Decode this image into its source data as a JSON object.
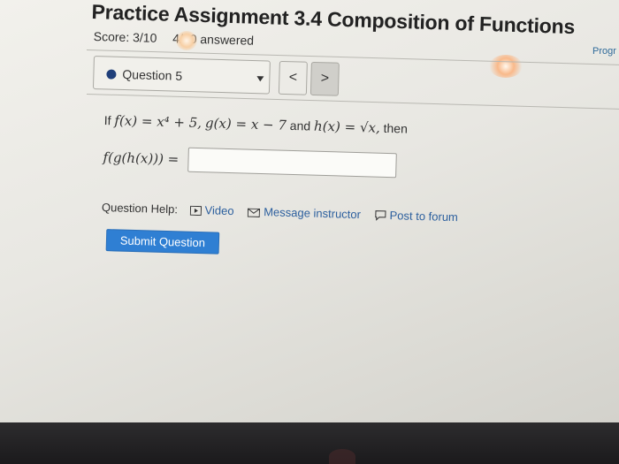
{
  "header": {
    "title": "Practice Assignment 3.4 Composition of Functions",
    "score": "Score: 3/10",
    "answered": "4/10 answered",
    "progress_label": "Progr"
  },
  "question_nav": {
    "selected_question": "Question 5",
    "prev_label": "<",
    "next_label": ">"
  },
  "problem": {
    "prefix": "If",
    "f_def": "f(x) = x⁴ + 5,",
    "g_def": "g(x) = x − 7",
    "and_text": "and",
    "h_def": "h(x) = √x,",
    "suffix": "then",
    "answer_prompt": "f(g(h(x))) =",
    "answer_value": ""
  },
  "help": {
    "label": "Question Help:",
    "video": "Video",
    "message": "Message instructor",
    "forum": "Post to forum"
  },
  "submit_label": "Submit Question",
  "colors": {
    "accent": "#2f7fd3",
    "link": "#2c5f9e",
    "question_dot": "#1f3f7a"
  }
}
